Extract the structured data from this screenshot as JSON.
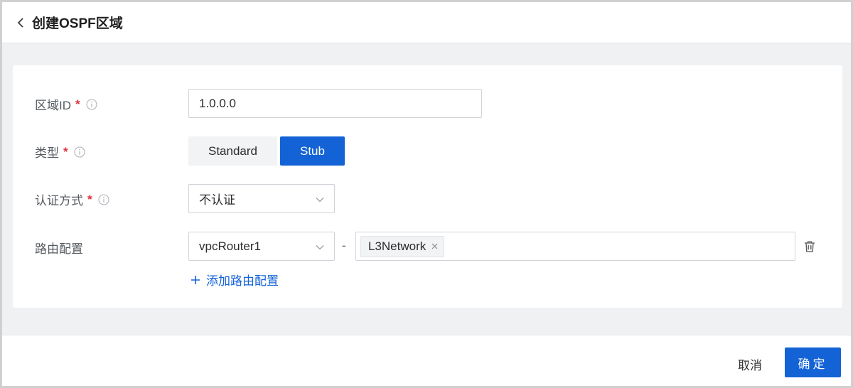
{
  "header": {
    "title": "创建OSPF区域"
  },
  "form": {
    "area_id": {
      "label": "区域ID",
      "required": "*",
      "value": "1.0.0.0"
    },
    "type": {
      "label": "类型",
      "required": "*",
      "options": [
        "Standard",
        "Stub"
      ],
      "selected": "Stub"
    },
    "auth": {
      "label": "认证方式",
      "required": "*",
      "value": "不认证"
    },
    "route": {
      "label": "路由配置",
      "router_value": "vpcRouter1",
      "separator": "-",
      "network_tags": [
        "L3Network"
      ],
      "add_label": "添加路由配置"
    }
  },
  "footer": {
    "cancel_label": "取消",
    "ok_label": "确定"
  },
  "colors": {
    "primary": "#1463d6",
    "required": "#e0303a",
    "background": "#f0f1f3"
  }
}
